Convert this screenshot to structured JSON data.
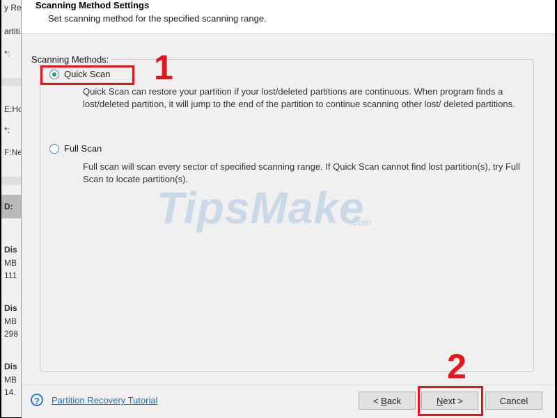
{
  "background_app": {
    "fragments": [
      "y Re",
      "artiti",
      "*:",
      "E:Ho",
      "*:",
      "F:Ne",
      "D:",
      "Dis",
      "MB",
      "111",
      "Dis",
      "MB",
      "298",
      "Dis",
      "MB",
      "14."
    ]
  },
  "dialog": {
    "title": "Scanning Method Settings",
    "subtitle": "Set scanning method for the specified scanning range.",
    "group_label": "Scanning Methods:",
    "options": [
      {
        "label": "Quick Scan",
        "checked": true,
        "description": "Quick Scan can restore your partition if your lost/deleted partitions are continuous. When program finds a lost/deleted partition, it will jump to the end of the partition to continue scanning other lost/ deleted partitions."
      },
      {
        "label": "Full Scan",
        "checked": false,
        "description": "Full scan will scan every sector of specified scanning range. If Quick Scan cannot find lost partition(s), try Full Scan to locate partition(s)."
      }
    ]
  },
  "footer": {
    "help_icon": "question-circle-icon",
    "help_link": "Partition Recovery Tutorial",
    "back": {
      "prefix": "< ",
      "underlined": "B",
      "rest": "ack"
    },
    "next": {
      "underlined": "N",
      "rest": "ext >"
    },
    "cancel": "Cancel"
  },
  "annotations": {
    "step1": "1",
    "step2": "2",
    "color": "#e8141b"
  },
  "watermark": {
    "main": "TipsMake",
    "suffix": ".com"
  }
}
